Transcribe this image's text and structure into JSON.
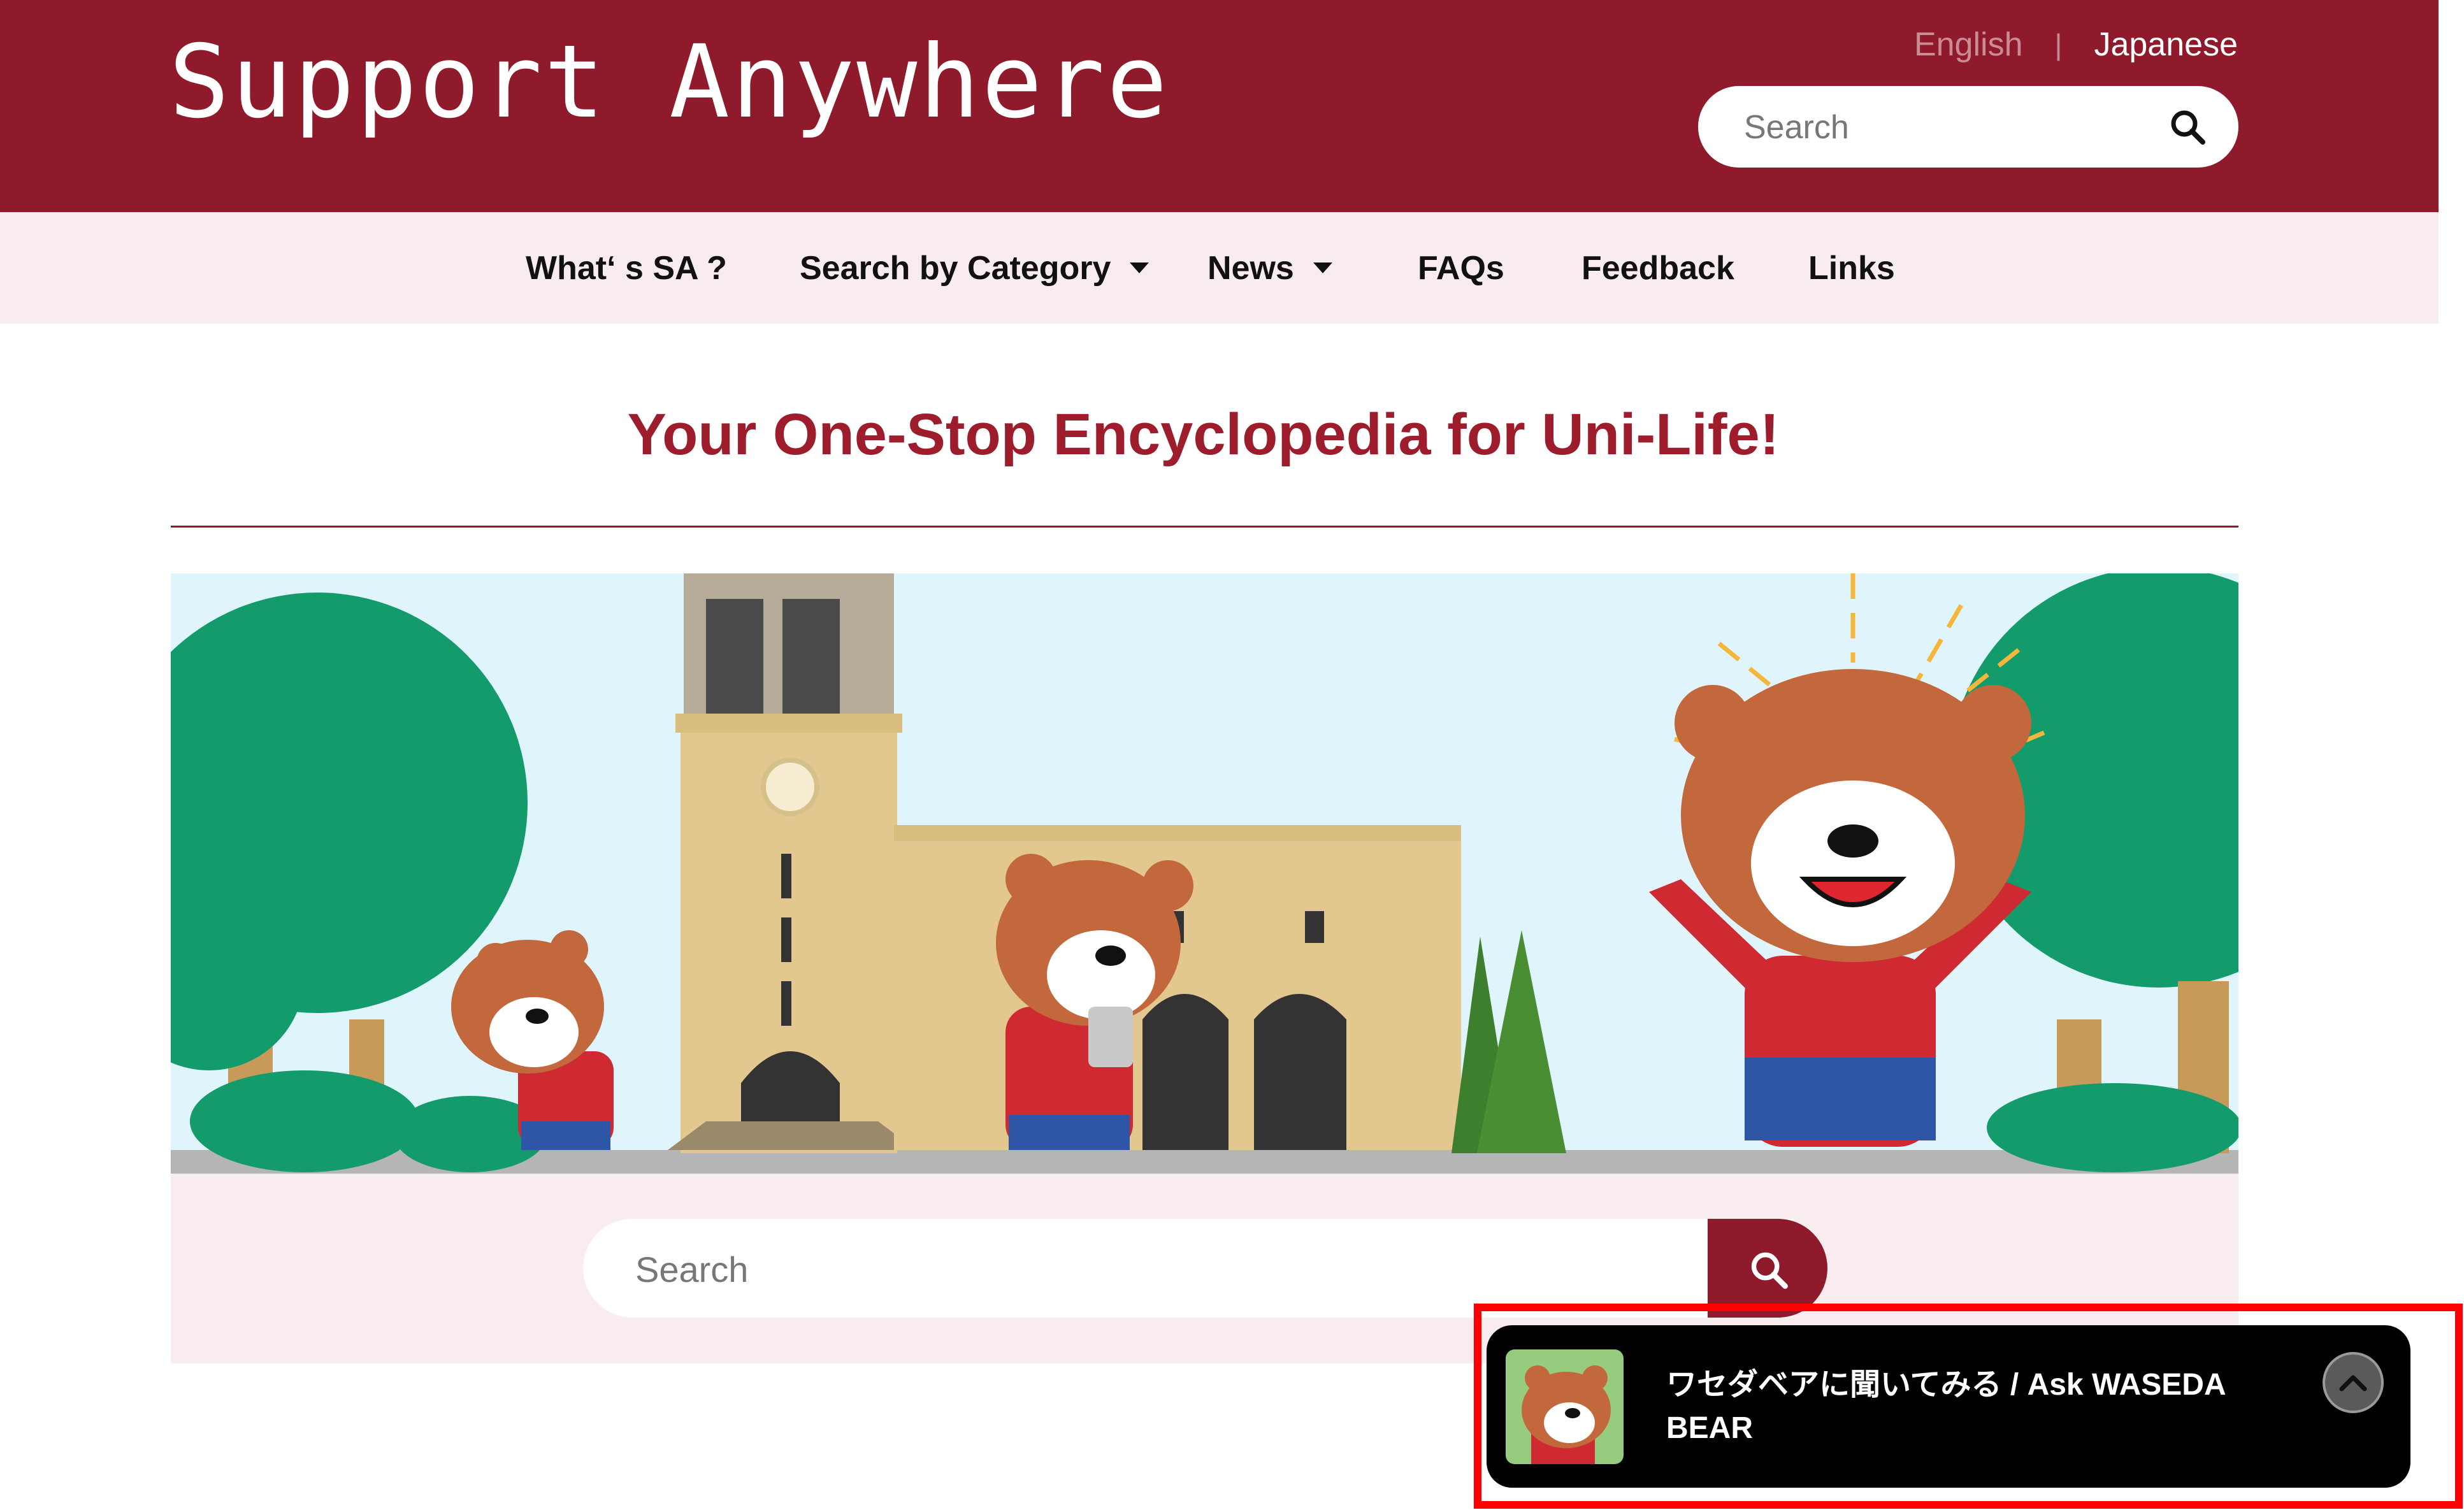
{
  "header": {
    "logo_text": "Support Anywhere",
    "lang_english": "English",
    "lang_separator": "|",
    "lang_japanese": "Japanese",
    "search_placeholder": "Search",
    "colors": {
      "brand": "#8f1a2b",
      "nav_bg": "#f8ecef"
    }
  },
  "nav": {
    "items": [
      {
        "label": "What‘ s SA ?"
      },
      {
        "label": "Search by Category",
        "icon": "caret-down-icon"
      },
      {
        "label": "News",
        "icon": "caret-down-icon"
      },
      {
        "label": "FAQs"
      },
      {
        "label": "Feedback"
      },
      {
        "label": "Links"
      }
    ]
  },
  "main": {
    "tagline": "Your One-Stop Encyclopedia for Uni-Life!",
    "hero_icon": "campus-bears-illustration",
    "search_placeholder": "Search",
    "search_icon": "search-icon"
  },
  "chat_widget": {
    "label_line1": "ワセダベアに聞いてみる / Ask WASEDA",
    "label_line2": "BEAR",
    "avatar_icon": "bear-avatar-icon",
    "toggle_icon": "chevron-up-icon",
    "highlight_color": "#ff0000"
  }
}
